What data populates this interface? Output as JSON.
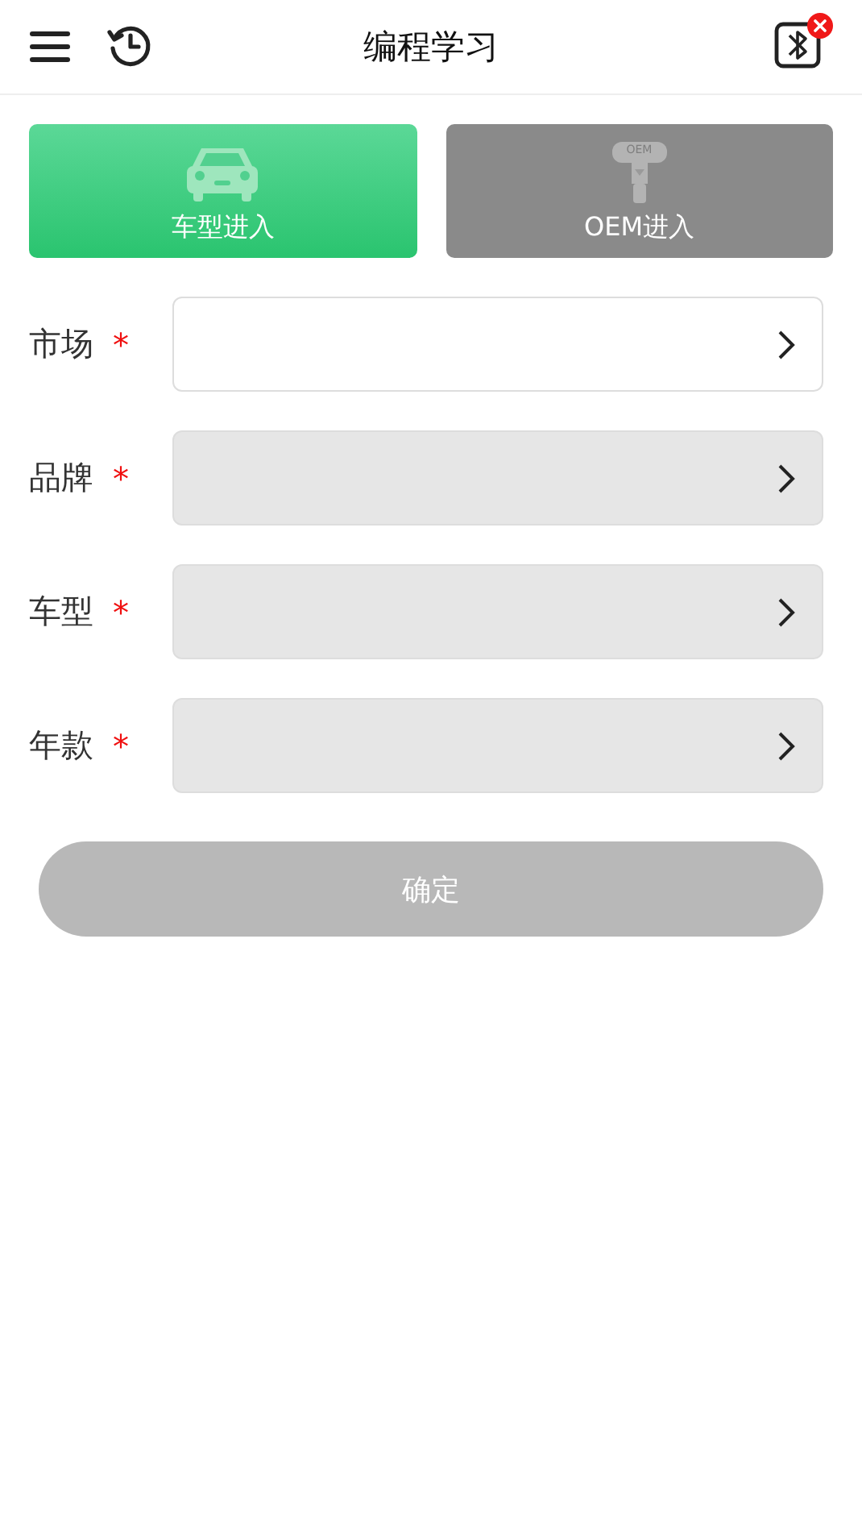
{
  "header": {
    "title": "编程学习",
    "bluetooth_connected": false
  },
  "entry_tabs": [
    {
      "kind": "car",
      "label": "车型进入",
      "selected": true
    },
    {
      "kind": "oem",
      "label": "OEM进入",
      "icon_text": "OEM",
      "selected": false
    }
  ],
  "fields": [
    {
      "label": "市场",
      "required_mark": "*",
      "disabled": false
    },
    {
      "label": "品牌",
      "required_mark": "*",
      "disabled": true
    },
    {
      "label": "车型",
      "required_mark": "*",
      "disabled": true
    },
    {
      "label": "年款",
      "required_mark": "*",
      "disabled": true
    }
  ],
  "confirm_button": {
    "label": "确定",
    "disabled": true
  }
}
